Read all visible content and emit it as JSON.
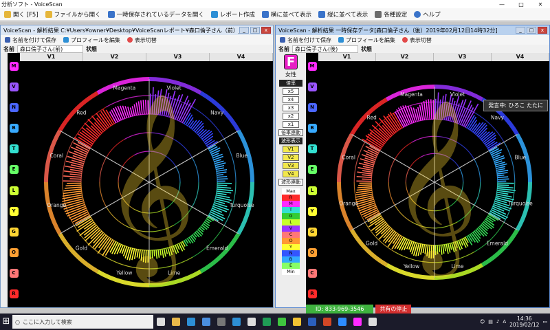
{
  "app": {
    "title": "分析ソフト - VoiceScan",
    "window_controls": [
      "—",
      "□",
      "✕"
    ]
  },
  "toolbar": [
    {
      "label": "開く [F5]",
      "icon": "open-icon",
      "color": "#e5b53a"
    },
    {
      "label": "ファイルから開く",
      "icon": "file-open-icon",
      "color": "#e5b53a"
    },
    {
      "label": "一時保存されているデータを開く",
      "icon": "temp-data-icon",
      "color": "#3a73c9"
    },
    {
      "label": "レポート作成",
      "icon": "report-icon",
      "color": "#2d8fd5"
    },
    {
      "label": "横に並べて表示",
      "icon": "tile-horizontal-icon",
      "color": "#3a73c9"
    },
    {
      "label": "縦に並べて表示",
      "icon": "tile-vertical-icon",
      "color": "#3a73c9"
    },
    {
      "label": "各種設定",
      "icon": "settings-icon",
      "color": "#6b6b6b"
    },
    {
      "label": "ヘルプ",
      "icon": "help-icon",
      "color": "#3a73c9"
    }
  ],
  "windows": [
    {
      "id": "left",
      "title": "VoiceScan - 解析結果 C:¥Users¥owner¥Desktop¥VoiceScanレポート¥森口倫子さん（前）_2019年02月12...",
      "tools": [
        "名前を付けて保存",
        "プロフィールを編集",
        "表示切替"
      ],
      "name_label": "名前",
      "name_value": "森口倫子さん(前)",
      "status_label": "状態"
    },
    {
      "id": "right",
      "title": "VoiceScan - 解析結果 一時保存データ[森口倫子さん（後）2019年02月12日14時32分]",
      "tools": [
        "名前を付けて保存",
        "プロフィールを編集",
        "表示切替"
      ],
      "name_label": "名前",
      "name_value": "森口倫子さん(後)",
      "status_label": "状態",
      "tooltip": "発言中: ひろこ たたに"
    }
  ],
  "sidebar": {
    "badge": "F",
    "gender": "女性",
    "magnify_label": "倍率",
    "magnify": [
      "x5",
      "x4",
      "x3",
      "x2",
      "x1"
    ],
    "magnify_link": "倍率連動",
    "wave_label": "波形表示",
    "waves": [
      "V1",
      "V2",
      "V3",
      "V4"
    ],
    "wave_link": "波形連動",
    "legend_top": "Max",
    "legend_bottom": "Min",
    "legend": [
      {
        "letter": "R",
        "color": "#ff2a2a"
      },
      {
        "letter": "M",
        "color": "#ff2aff"
      },
      {
        "letter": "T",
        "color": "#33e0d0"
      },
      {
        "letter": "G",
        "color": "#33cc33"
      },
      {
        "letter": "L",
        "color": "#c8ff2a"
      },
      {
        "letter": "V",
        "color": "#9933ff"
      },
      {
        "letter": "C",
        "color": "#ff7777"
      },
      {
        "letter": "O",
        "color": "#ff9933"
      },
      {
        "letter": "Y",
        "color": "#ffff33"
      },
      {
        "letter": "N",
        "color": "#3355ff"
      },
      {
        "letter": "B",
        "color": "#33aaff"
      },
      {
        "letter": "E",
        "color": "#88ff66"
      }
    ]
  },
  "strip": [
    {
      "letter": "M",
      "color": "#ff2aff"
    },
    {
      "letter": "V",
      "color": "#9a55ff"
    },
    {
      "letter": "N",
      "color": "#4a66ff"
    },
    {
      "letter": "B",
      "color": "#38aaff"
    },
    {
      "letter": "T",
      "color": "#33e0d0"
    },
    {
      "letter": "E",
      "color": "#66ff66"
    },
    {
      "letter": "L",
      "color": "#ccff33"
    },
    {
      "letter": "Y",
      "color": "#ffff33"
    },
    {
      "letter": "G",
      "color": "#ffd633"
    },
    {
      "letter": "O",
      "color": "#ffa033"
    },
    {
      "letter": "C",
      "color": "#ff7777"
    },
    {
      "letter": "R",
      "color": "#ff2a2a"
    }
  ],
  "chart_data": {
    "type": "radial",
    "vheaders": [
      "V1",
      "V2",
      "V3",
      "V4"
    ],
    "sectors": [
      {
        "name": "Red",
        "color": "#ff2a2a"
      },
      {
        "name": "Magenta",
        "color": "#ff2aff"
      },
      {
        "name": "Violet",
        "color": "#9933ff"
      },
      {
        "name": "Navy",
        "color": "#3344ff"
      },
      {
        "name": "Blue",
        "color": "#33aaff"
      },
      {
        "name": "Turquoise",
        "color": "#33e0d0"
      },
      {
        "name": "Emerald",
        "color": "#33dd55"
      },
      {
        "name": "Lime",
        "color": "#c8ff2a"
      },
      {
        "name": "Yellow",
        "color": "#ffff33"
      },
      {
        "name": "Gold",
        "color": "#ffcc33"
      },
      {
        "name": "Orange",
        "color": "#ff9933"
      },
      {
        "name": "Coral",
        "color": "#ff6655"
      }
    ],
    "before": [
      0.55,
      0.4,
      0.75,
      0.35,
      0.3,
      0.45,
      0.2,
      0.25,
      0.35,
      0.55,
      0.6,
      0.5
    ],
    "after": [
      0.65,
      0.6,
      0.8,
      0.45,
      0.35,
      0.55,
      0.35,
      0.3,
      0.4,
      0.5,
      0.55,
      0.45
    ]
  },
  "share": {
    "id": "ID: 833-969-3546",
    "stop": "共有の停止"
  },
  "taskbar": {
    "search_placeholder": "ここに入力して検索",
    "time": "14:36",
    "date": "2019/02/12",
    "ime": "A",
    "apps": [
      {
        "icon": "task-view-icon",
        "color": "#dddddd"
      },
      {
        "icon": "explorer-icon",
        "color": "#e8b84a"
      },
      {
        "icon": "edge-icon",
        "color": "#2d8fd5"
      },
      {
        "icon": "store-icon",
        "color": "#4a8fe0"
      },
      {
        "icon": "calculator-icon",
        "color": "#777777"
      },
      {
        "icon": "ie-icon",
        "color": "#2d8fd5"
      },
      {
        "icon": "mail-icon",
        "color": "#dddddd"
      },
      {
        "icon": "excel-icon",
        "color": "#1f9d55"
      },
      {
        "icon": "line-icon",
        "color": "#3fc53f"
      },
      {
        "icon": "chrome-icon",
        "color": "#f2c233"
      },
      {
        "icon": "word-icon",
        "color": "#2b5fbf"
      },
      {
        "icon": "powerpoint-icon",
        "color": "#d24726"
      },
      {
        "icon": "zoom-icon",
        "color": "#2d8cff"
      },
      {
        "icon": "voicescan-icon",
        "color": "#ff2aff"
      },
      {
        "icon": "chat-icon",
        "color": "#dddddd"
      }
    ]
  }
}
